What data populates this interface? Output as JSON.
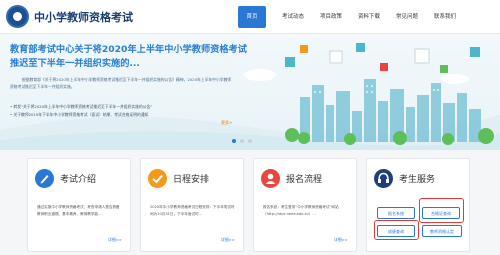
{
  "header": {
    "site_title": "中小学教师资格考试",
    "nav": [
      "首页",
      "考试动态",
      "项目政策",
      "资料下载",
      "常见问题",
      "联系我们"
    ]
  },
  "banner": {
    "title": "教育部考试中心关于将2020年上半年中小学教师资格考试推迟至下半年一并组织实施的...",
    "body": "根据教育部《关于将2020年上半年中小学教师资格考试推迟至下半年一并组织实施的公告》精神，2020年上半年中小学教师资格考试推迟至下半年一并组织实施。",
    "list": [
      "• 转发“关于将2020年上半年中小学教师资格考试推迟至下半年一并组织实施的公告”",
      "• 关于教师2019年下半年中小学教师资格考试（面试）结果、考试合格证明的通知"
    ],
    "more": "更多>"
  },
  "cards": [
    {
      "title": "考试介绍",
      "text": "通过实施中小学教师资格考试，考查申请人是否具备教师职业道德、基本素养、教育教学能...",
      "more": "详细>>"
    },
    {
      "title": "日程安排",
      "text": "2020年中小学教师资格考试日程安排：下半年笔试时间为10月31日，下半年面试时...",
      "more": "详细>>"
    },
    {
      "title": "报名流程",
      "text": "报名系统：考生登录“中小学教师资格考试”网站（http://ntce.neea.edu.cn）...",
      "more": "详细>>"
    },
    {
      "title": "考生服务",
      "buttons": [
        "报名系统",
        "合格证查询",
        "成绩查询",
        "教师资格认定"
      ]
    }
  ],
  "colors": {
    "accent": "#2a77d6",
    "highlight": "#e53935",
    "card_icon_1": "#2a77d6",
    "card_icon_2": "#f39a1e",
    "card_icon_3": "#e8463f",
    "card_icon_4": "#1f3f7a"
  },
  "icons": [
    "logo-emblem",
    "pencil-icon",
    "checkmark-icon",
    "person-icon",
    "headset-icon"
  ]
}
